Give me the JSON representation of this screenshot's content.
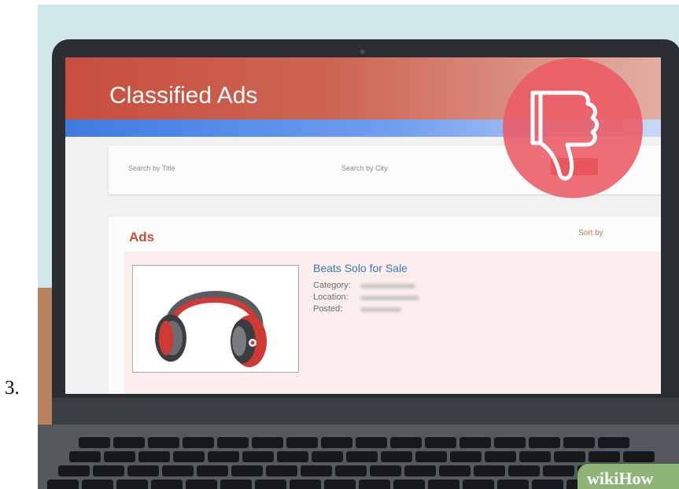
{
  "step": {
    "number": "3."
  },
  "screen": {
    "header": {
      "title": "Classified Ads"
    },
    "search": {
      "title_placeholder": "Search by Title",
      "city_placeholder": "Search by City"
    },
    "ads": {
      "heading": "Ads",
      "sort_label": "Sort by",
      "listing": {
        "title": "Beats Solo for Sale",
        "category_label": "Category:",
        "location_label": "Location:",
        "posted_label": "Posted:",
        "image_icon": "headphones-icon"
      }
    }
  },
  "overlay": {
    "icon": "thumbs-down-icon"
  },
  "watermark": {
    "text": "wikiHow"
  },
  "colors": {
    "header_red": "#c84e3e",
    "accent_blue": "#3e7be0",
    "dislike_pink": "#ec5a64",
    "link_blue": "#3a76c0"
  }
}
